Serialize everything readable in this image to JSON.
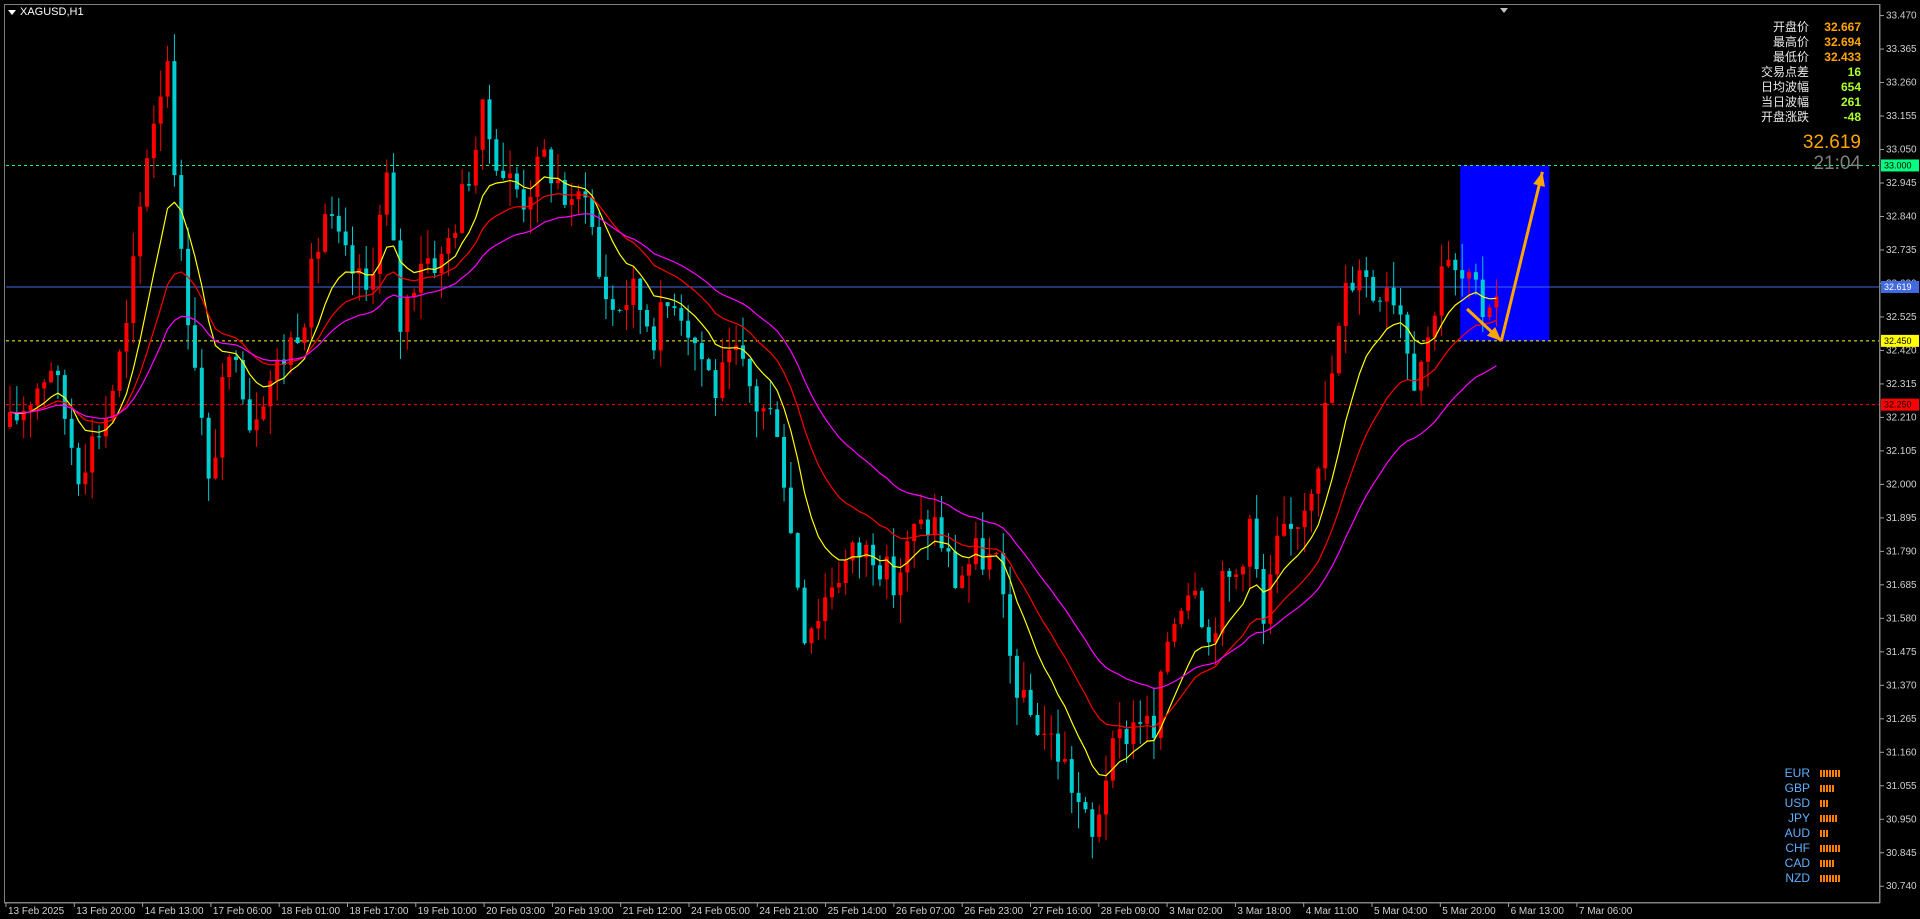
{
  "chart_title": "XAGUSD,H1",
  "info_panel": [
    {
      "label": "开盘价",
      "value": "32.667",
      "color": "#ffa500"
    },
    {
      "label": "最高价",
      "value": "32.694",
      "color": "#ffa500"
    },
    {
      "label": "最低价",
      "value": "32.433",
      "color": "#ffa500"
    },
    {
      "label": "交易点差",
      "value": "16",
      "color": "#adff2f"
    },
    {
      "label": "日均波幅",
      "value": "654",
      "color": "#adff2f"
    },
    {
      "label": "当日波幅",
      "value": "261",
      "color": "#adff2f"
    },
    {
      "label": "开盘涨跌",
      "value": "-48",
      "color": "#adff2f"
    }
  ],
  "big_price": "32.619",
  "big_time": "21:04",
  "currency_strength": [
    {
      "label": "EUR",
      "level": 7
    },
    {
      "label": "GBP",
      "level": 5
    },
    {
      "label": "USD",
      "level": 3
    },
    {
      "label": "JPY",
      "level": 6
    },
    {
      "label": "AUD",
      "level": 3
    },
    {
      "label": "CHF",
      "level": 7
    },
    {
      "label": "CAD",
      "level": 5
    },
    {
      "label": "NZD",
      "level": 7
    }
  ],
  "chart_data": {
    "type": "candlestick",
    "symbol": "XAGUSD",
    "timeframe": "H1",
    "ylim": [
      30.7,
      33.5
    ],
    "y_ticks": [
      "33.470",
      "33.365",
      "33.260",
      "33.155",
      "33.050",
      "32.945",
      "32.840",
      "32.735",
      "32.630",
      "32.525",
      "32.420",
      "32.315",
      "32.210",
      "32.105",
      "32.000",
      "31.895",
      "31.790",
      "31.685",
      "31.580",
      "31.475",
      "31.370",
      "31.265",
      "31.160",
      "31.055",
      "30.950",
      "30.845",
      "30.740"
    ],
    "x_ticks": [
      "13 Feb 2025",
      "13 Feb 20:00",
      "14 Feb 13:00",
      "17 Feb 06:00",
      "18 Feb 01:00",
      "18 Feb 17:00",
      "19 Feb 10:00",
      "20 Feb 03:00",
      "20 Feb 19:00",
      "21 Feb 12:00",
      "24 Feb 05:00",
      "24 Feb 21:00",
      "25 Feb 14:00",
      "26 Feb 07:00",
      "26 Feb 23:00",
      "27 Feb 16:00",
      "28 Feb 09:00",
      "3 Mar 02:00",
      "3 Mar 18:00",
      "4 Mar 11:00",
      "5 Mar 04:00",
      "5 Mar 20:00",
      "6 Mar 13:00",
      "7 Mar 06:00"
    ],
    "bull_color": "#ff0000",
    "bear_color": "#00ced1",
    "price_path": [
      [
        0,
        32.18
      ],
      [
        6,
        32.38
      ],
      [
        10,
        32.05
      ],
      [
        14,
        32.22
      ],
      [
        17,
        32.48
      ],
      [
        20,
        33.05
      ],
      [
        23,
        33.35
      ],
      [
        25,
        32.7
      ],
      [
        27,
        32.4
      ],
      [
        29,
        31.98
      ],
      [
        31,
        32.28
      ],
      [
        33,
        32.45
      ],
      [
        35,
        32.2
      ],
      [
        37,
        32.3
      ],
      [
        40,
        32.4
      ],
      [
        43,
        32.55
      ],
      [
        46,
        32.85
      ],
      [
        49,
        32.7
      ],
      [
        52,
        32.6
      ],
      [
        55,
        32.95
      ],
      [
        57,
        32.5
      ],
      [
        60,
        32.72
      ],
      [
        63,
        32.7
      ],
      [
        66,
        32.9
      ],
      [
        69,
        33.15
      ],
      [
        72,
        32.98
      ],
      [
        75,
        32.9
      ],
      [
        78,
        33.02
      ],
      [
        80,
        32.95
      ],
      [
        82,
        32.85
      ],
      [
        84,
        32.95
      ],
      [
        86,
        32.65
      ],
      [
        88,
        32.55
      ],
      [
        91,
        32.6
      ],
      [
        94,
        32.48
      ],
      [
        97,
        32.6
      ],
      [
        100,
        32.45
      ],
      [
        103,
        32.3
      ],
      [
        106,
        32.4
      ],
      [
        109,
        32.25
      ],
      [
        112,
        32.2
      ],
      [
        114,
        31.85
      ],
      [
        116,
        31.55
      ],
      [
        118,
        31.6
      ],
      [
        120,
        31.7
      ],
      [
        123,
        31.78
      ],
      [
        126,
        31.8
      ],
      [
        129,
        31.68
      ],
      [
        132,
        31.85
      ],
      [
        135,
        31.88
      ],
      [
        138,
        31.7
      ],
      [
        141,
        31.78
      ],
      [
        144,
        31.75
      ],
      [
        146,
        31.45
      ],
      [
        148,
        31.3
      ],
      [
        150,
        31.25
      ],
      [
        152,
        31.2
      ],
      [
        154,
        31.12
      ],
      [
        156,
        31.0
      ],
      [
        158,
        30.88
      ],
      [
        160,
        31.1
      ],
      [
        162,
        31.2
      ],
      [
        165,
        31.28
      ],
      [
        167,
        31.2
      ],
      [
        169,
        31.52
      ],
      [
        171,
        31.65
      ],
      [
        173,
        31.72
      ],
      [
        175,
        31.5
      ],
      [
        177,
        31.68
      ],
      [
        179,
        31.72
      ],
      [
        181,
        31.88
      ],
      [
        183,
        31.55
      ],
      [
        185,
        31.8
      ],
      [
        187,
        31.85
      ],
      [
        189,
        31.95
      ],
      [
        191,
        32.1
      ],
      [
        193,
        32.35
      ],
      [
        195,
        32.6
      ],
      [
        197,
        32.7
      ],
      [
        199,
        32.6
      ],
      [
        201,
        32.65
      ],
      [
        203,
        32.55
      ],
      [
        205,
        32.35
      ],
      [
        207,
        32.45
      ],
      [
        209,
        32.7
      ],
      [
        211,
        32.65
      ],
      [
        213,
        32.62
      ],
      [
        215,
        32.55
      ],
      [
        217,
        32.62
      ]
    ],
    "bars": 218,
    "overlay": {
      "resistance_line": {
        "value": 33.0,
        "label": "33.000",
        "color": "#00ff7f"
      },
      "current_price_line": {
        "value": 32.619,
        "label": "32.619",
        "color": "#4169e1"
      },
      "support_line": {
        "value": 32.45,
        "label": "32.450",
        "color": "#ffff00"
      },
      "stop_line": {
        "value": 32.25,
        "label": "32.250",
        "color": "#ff0000"
      },
      "target_box": {
        "x_from": 212,
        "x_to": 225,
        "y_from": 32.45,
        "y_to": 33.0,
        "color": "#0000ff"
      },
      "arrow_down": {
        "from": [
          213,
          32.55
        ],
        "to": [
          218,
          32.45
        ],
        "color": "#ffa500"
      },
      "arrow_up": {
        "from": [
          218,
          32.45
        ],
        "to": [
          224,
          32.98
        ],
        "color": "#ffa500"
      }
    },
    "moving_averages": [
      {
        "period": 10,
        "color": "#ffff00"
      },
      {
        "period": 20,
        "color": "#ff0000"
      },
      {
        "period": 34,
        "color": "#ff00ff"
      }
    ]
  }
}
